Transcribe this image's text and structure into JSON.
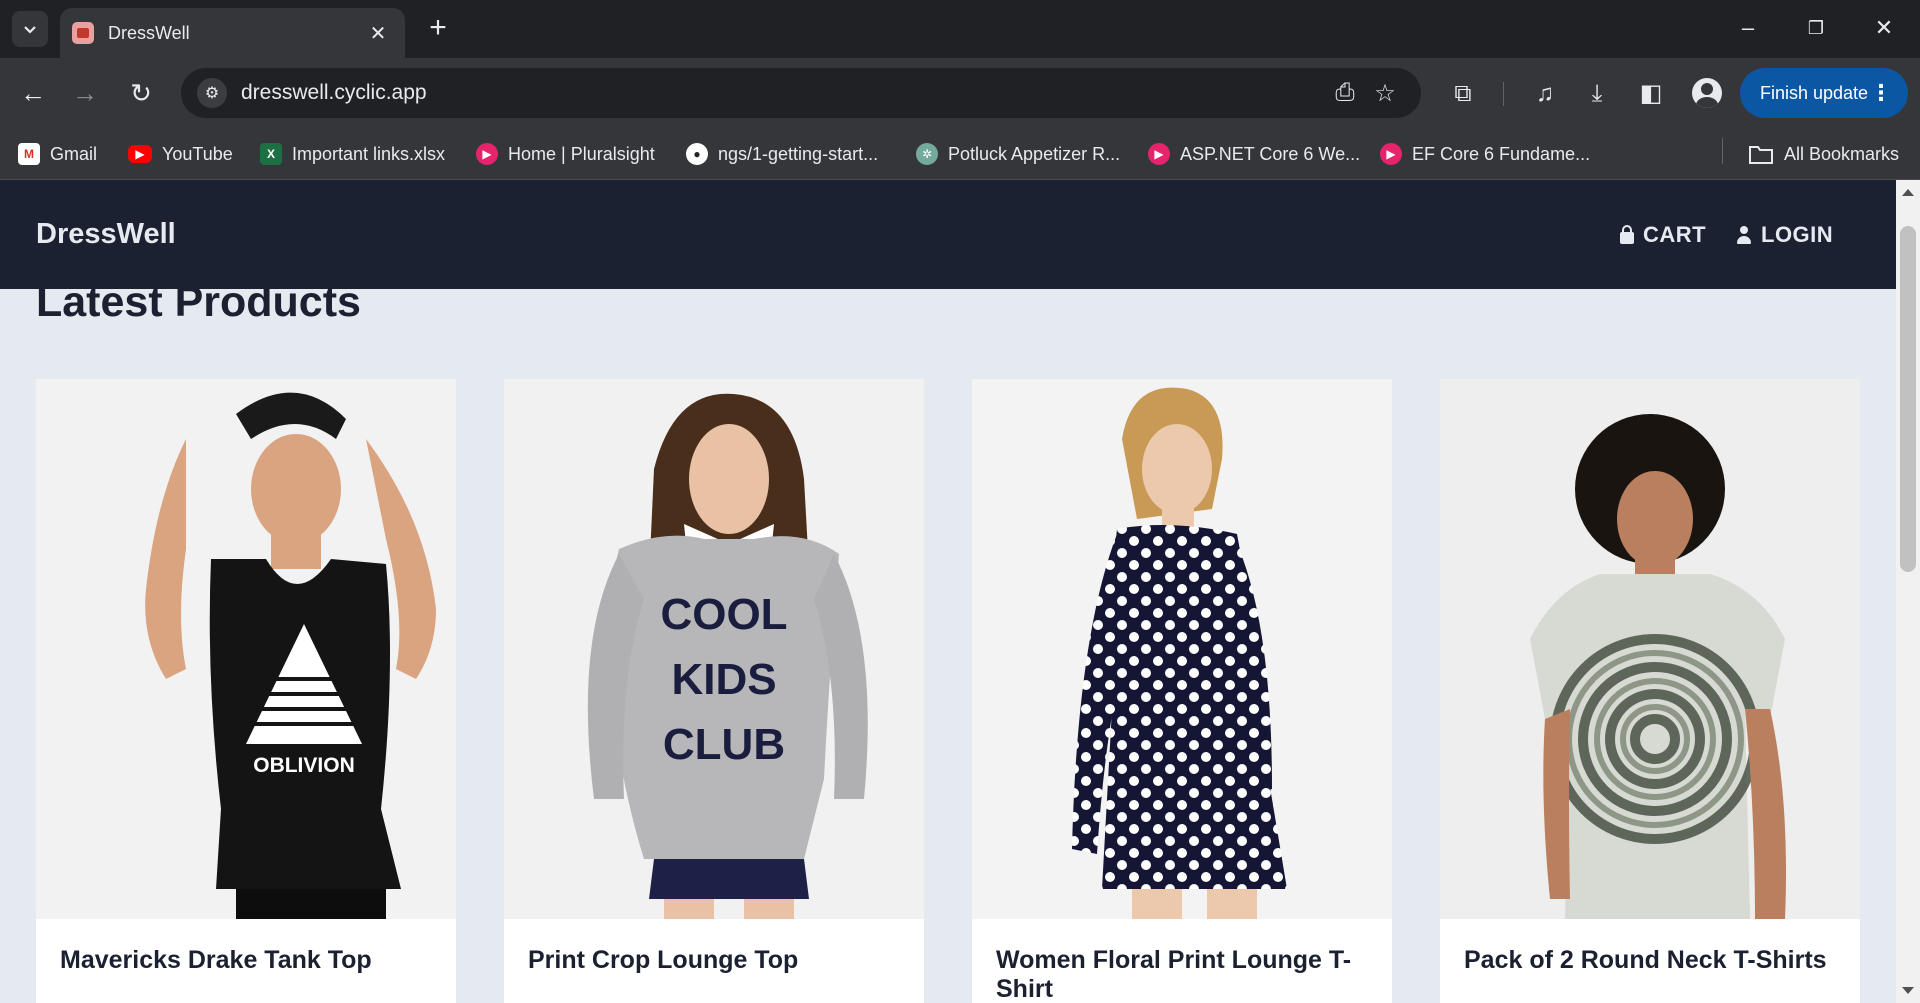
{
  "browser": {
    "tab_title": "DressWell",
    "url": "dresswell.cyclic.app",
    "finish_update_label": "Finish update",
    "bookmarks": [
      {
        "label": "Gmail",
        "icon": "gmail-icon"
      },
      {
        "label": "YouTube",
        "icon": "youtube-icon"
      },
      {
        "label": "Important links.xlsx",
        "icon": "excel-icon"
      },
      {
        "label": "Home | Pluralsight",
        "icon": "pluralsight-icon"
      },
      {
        "label": "ngs/1-getting-start...",
        "icon": "github-icon"
      },
      {
        "label": "Potluck Appetizer R...",
        "icon": "chatgpt-icon"
      },
      {
        "label": "ASP.NET Core 6 We...",
        "icon": "pluralsight-icon"
      },
      {
        "label": "EF Core 6 Fundame...",
        "icon": "pluralsight-icon"
      }
    ],
    "all_bookmarks_label": "All Bookmarks"
  },
  "site": {
    "brand": "DressWell",
    "nav": {
      "cart": "CART",
      "login": "LOGIN"
    },
    "section_title": "Latest Products",
    "products": [
      {
        "name": "Mavericks Drake Tank Top",
        "image": "man in black tank top with triangle print"
      },
      {
        "name": "Print Crop Lounge Top",
        "image": "woman in grey sweatshirt with COOL KIDS CLUB print"
      },
      {
        "name": "Women Floral Print Lounge T-Shirt",
        "image": "woman in navy polka dot dress"
      },
      {
        "name": "Pack of 2 Round Neck T-Shirts",
        "image": "man in tie-dye t-shirt"
      }
    ],
    "print_text": {
      "oblivion": "OBLIVION",
      "cool_kids_club": [
        "COOL",
        "KIDS",
        "CLUB"
      ]
    }
  },
  "colors": {
    "header_bg": "#1b2130",
    "page_bg": "#e5e9f0",
    "update_button": "#0b57a4"
  }
}
